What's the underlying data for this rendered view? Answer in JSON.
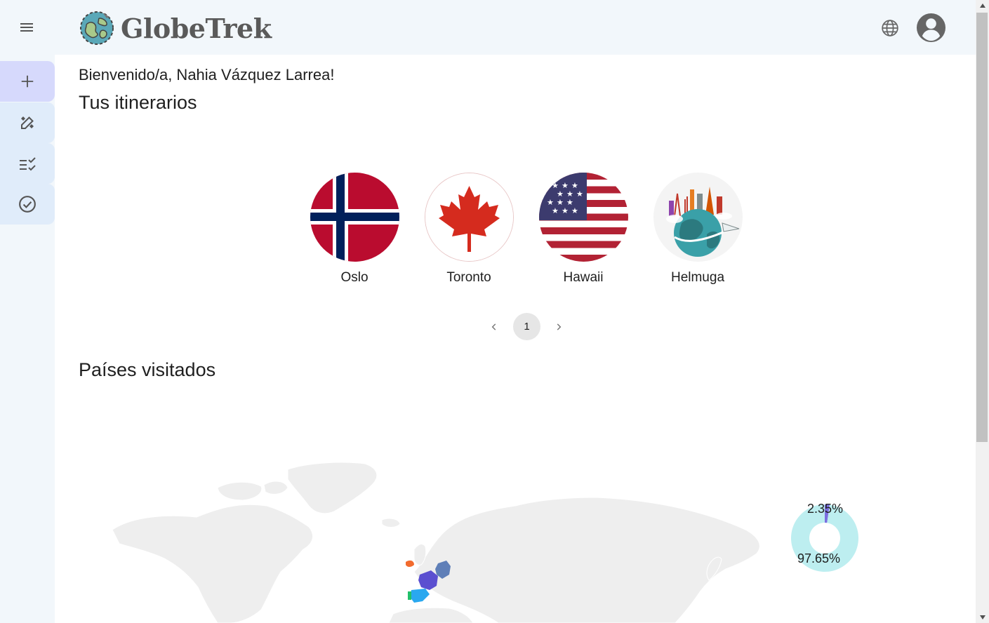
{
  "app": {
    "title": "GlobeTrek"
  },
  "header": {
    "menu_icon": "hamburger-menu-icon",
    "language_icon": "globe-icon",
    "profile_icon": "account-circle-icon"
  },
  "rail": {
    "items": [
      {
        "icon": "plus-icon",
        "active": true
      },
      {
        "icon": "edit-pencil-icon",
        "active": false
      },
      {
        "icon": "checklist-icon",
        "active": false
      },
      {
        "icon": "check-circle-icon",
        "active": false
      }
    ]
  },
  "main": {
    "welcome": "Bienvenido/a, Nahia Vázquez Larrea!",
    "itineraries_title": "Tus itinerarios",
    "itineraries": [
      {
        "name": "Oslo",
        "image": "norway-flag"
      },
      {
        "name": "Toronto",
        "image": "canada-flag"
      },
      {
        "name": "Hawaii",
        "image": "usa-flag"
      },
      {
        "name": "Helmuga",
        "image": "world-landmarks-globe"
      }
    ],
    "pagination": {
      "current_page": "1"
    },
    "visited_title": "Países visitados"
  },
  "chart_data": {
    "type": "pie",
    "values": [
      2.35,
      97.65
    ],
    "labels": [
      "2.35%",
      "97.65%"
    ],
    "colors": [
      "#7b6fe0",
      "#bdeef0"
    ]
  },
  "visited_map": {
    "countries": [
      "Ireland",
      "France",
      "Germany",
      "Spain",
      "Portugal"
    ],
    "colors": {
      "Ireland": "#f26b2e",
      "France": "#5b4fd0",
      "Germany": "#5f7fb8",
      "Spain": "#2aa8ef",
      "Portugal": "#22c06a",
      "base": "#eeeeee"
    }
  }
}
